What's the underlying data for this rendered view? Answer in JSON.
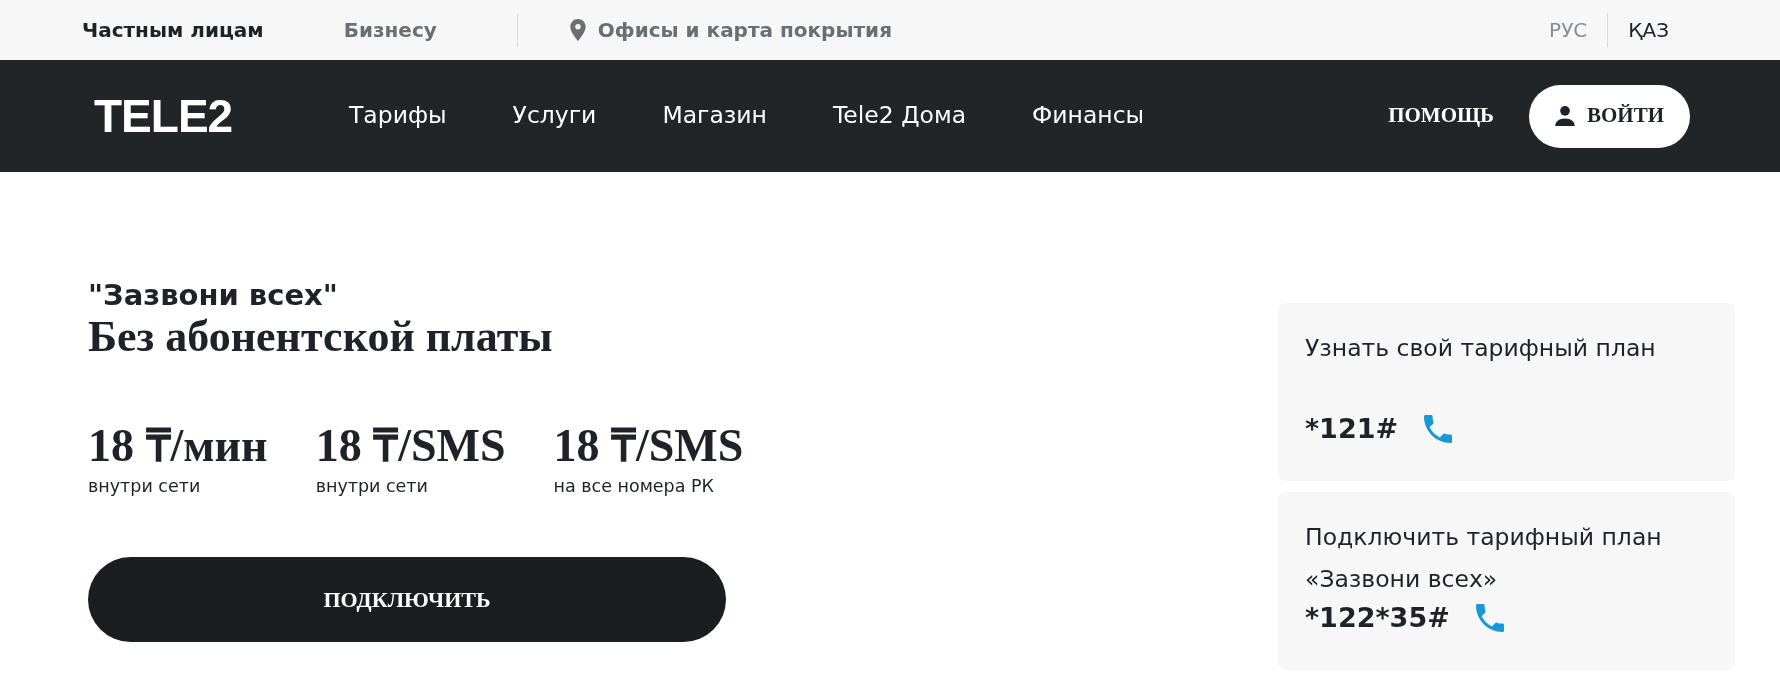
{
  "top_bar": {
    "segments": [
      {
        "label": "Частным лицам",
        "selected": true
      },
      {
        "label": "Бизнесу",
        "selected": false
      }
    ],
    "offices_link": "Офисы и карта покрытия",
    "languages": [
      {
        "label": "РУС",
        "selected": true
      },
      {
        "label": "ҚАЗ",
        "selected": false
      }
    ]
  },
  "navbar": {
    "logo": "TELE2",
    "items": [
      "Тарифы",
      "Услуги",
      "Магазин",
      "Tele2 Дома",
      "Финансы"
    ],
    "help": "ПОМОЩЬ",
    "login": "ВОЙТИ"
  },
  "tariff": {
    "name": "\"Зазвони всех\"",
    "headline": "Без абонентской платы",
    "prices": [
      {
        "value": "18 ₸/мин",
        "note": "внутри сети"
      },
      {
        "value": "18 ₸/SMS",
        "note": "внутри сети"
      },
      {
        "value": "18 ₸/SMS",
        "note": "на все номера РК"
      }
    ],
    "connect_button": "ПОДКЛЮЧИТЬ"
  },
  "ussd_cards": [
    {
      "title": "Узнать свой тарифный план",
      "code": "*121#"
    },
    {
      "title": "Подключить тарифный план «Зазвони всех»",
      "code": "*122*35#"
    }
  ]
}
